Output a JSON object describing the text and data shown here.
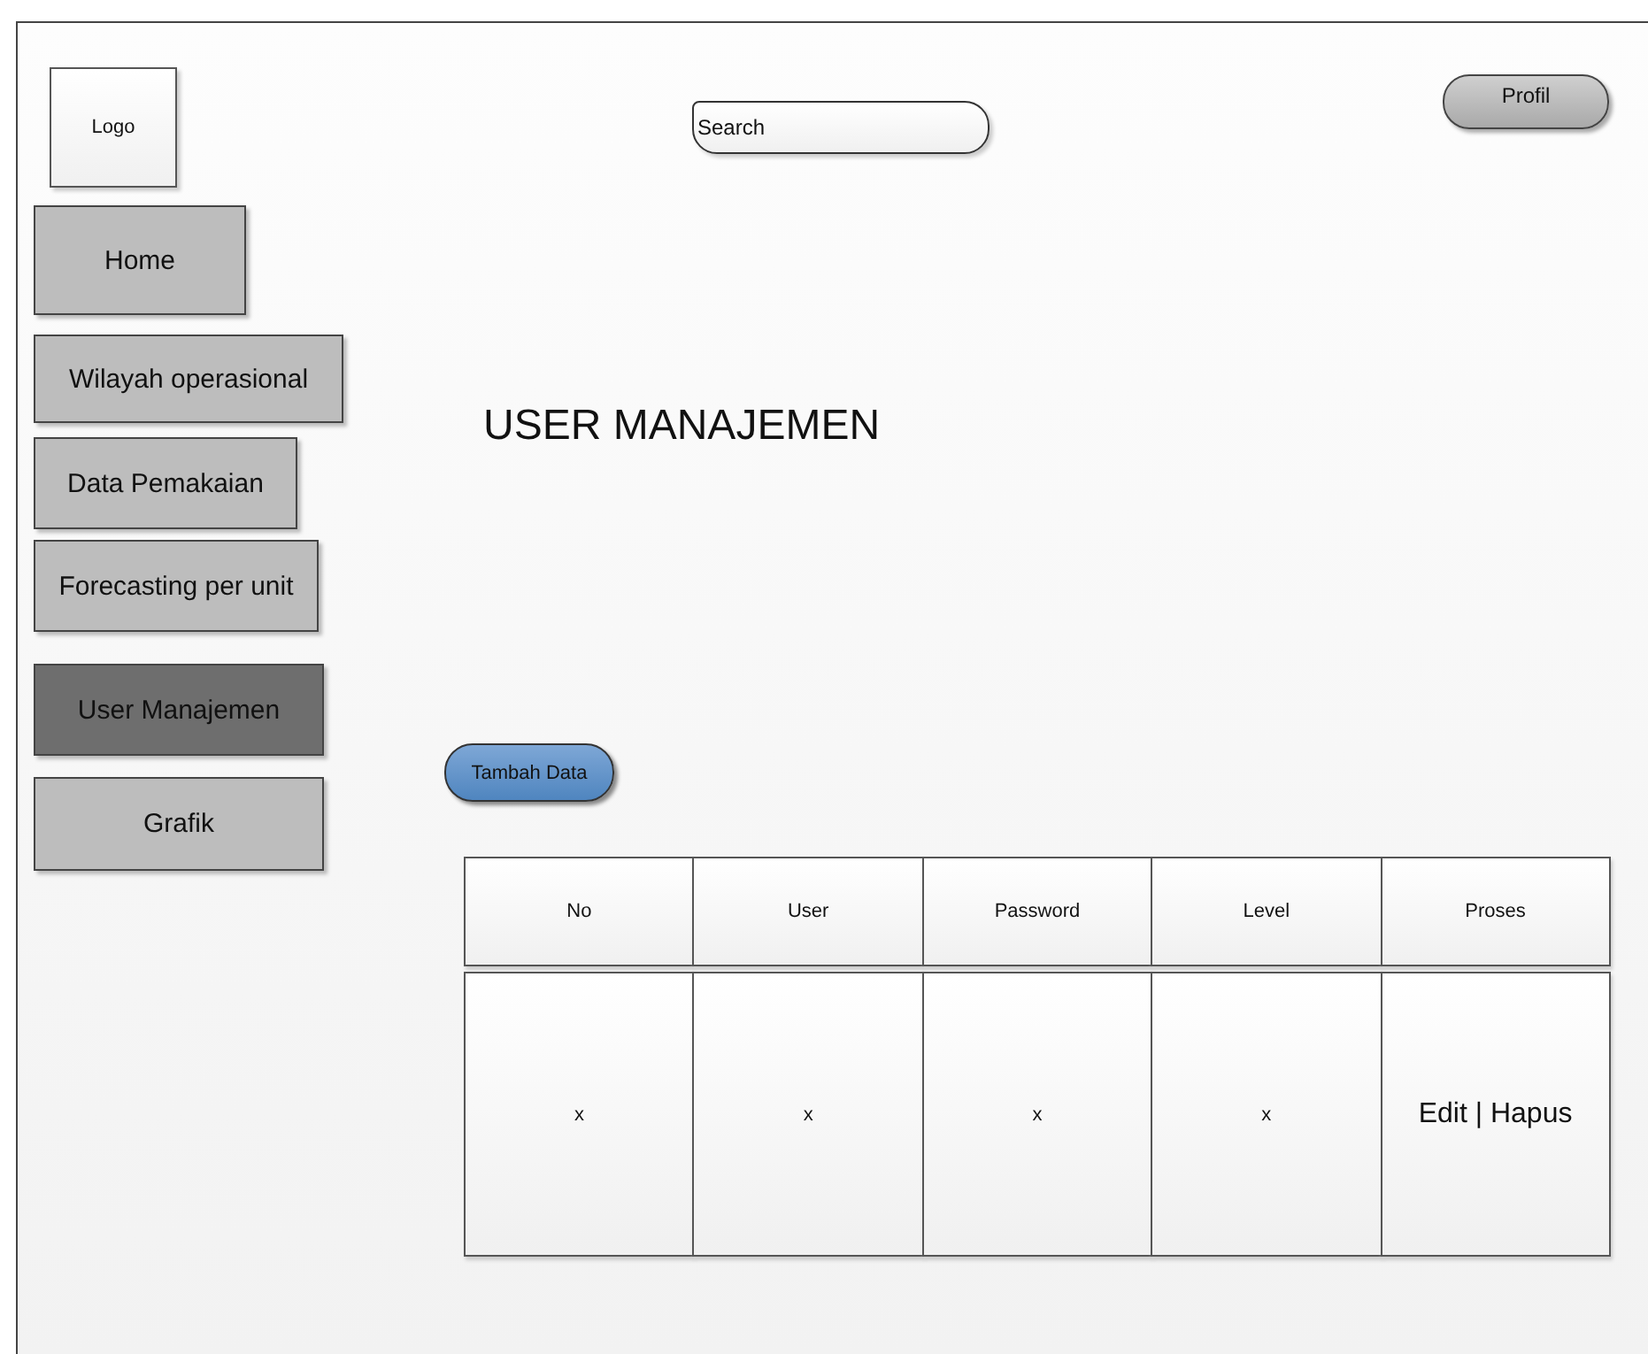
{
  "logo": "Logo",
  "search": {
    "placeholder": "Search"
  },
  "profile_button": "Profil",
  "sidebar": {
    "items": [
      {
        "label": "Home",
        "selected": false
      },
      {
        "label": "Wilayah operasional",
        "selected": false
      },
      {
        "label": "Data Pemakaian",
        "selected": false
      },
      {
        "label": "Forecasting per unit",
        "selected": false
      },
      {
        "label": "User Manajemen",
        "selected": true
      },
      {
        "label": "Grafik",
        "selected": false
      }
    ]
  },
  "page_title": "USER MANAJEMEN",
  "add_button": "Tambah Data",
  "table": {
    "columns": [
      "No",
      "User",
      "Password",
      "Level",
      "Proses"
    ],
    "rows": [
      [
        "x",
        "x",
        "x",
        "x",
        "Edit | Hapus"
      ]
    ]
  }
}
